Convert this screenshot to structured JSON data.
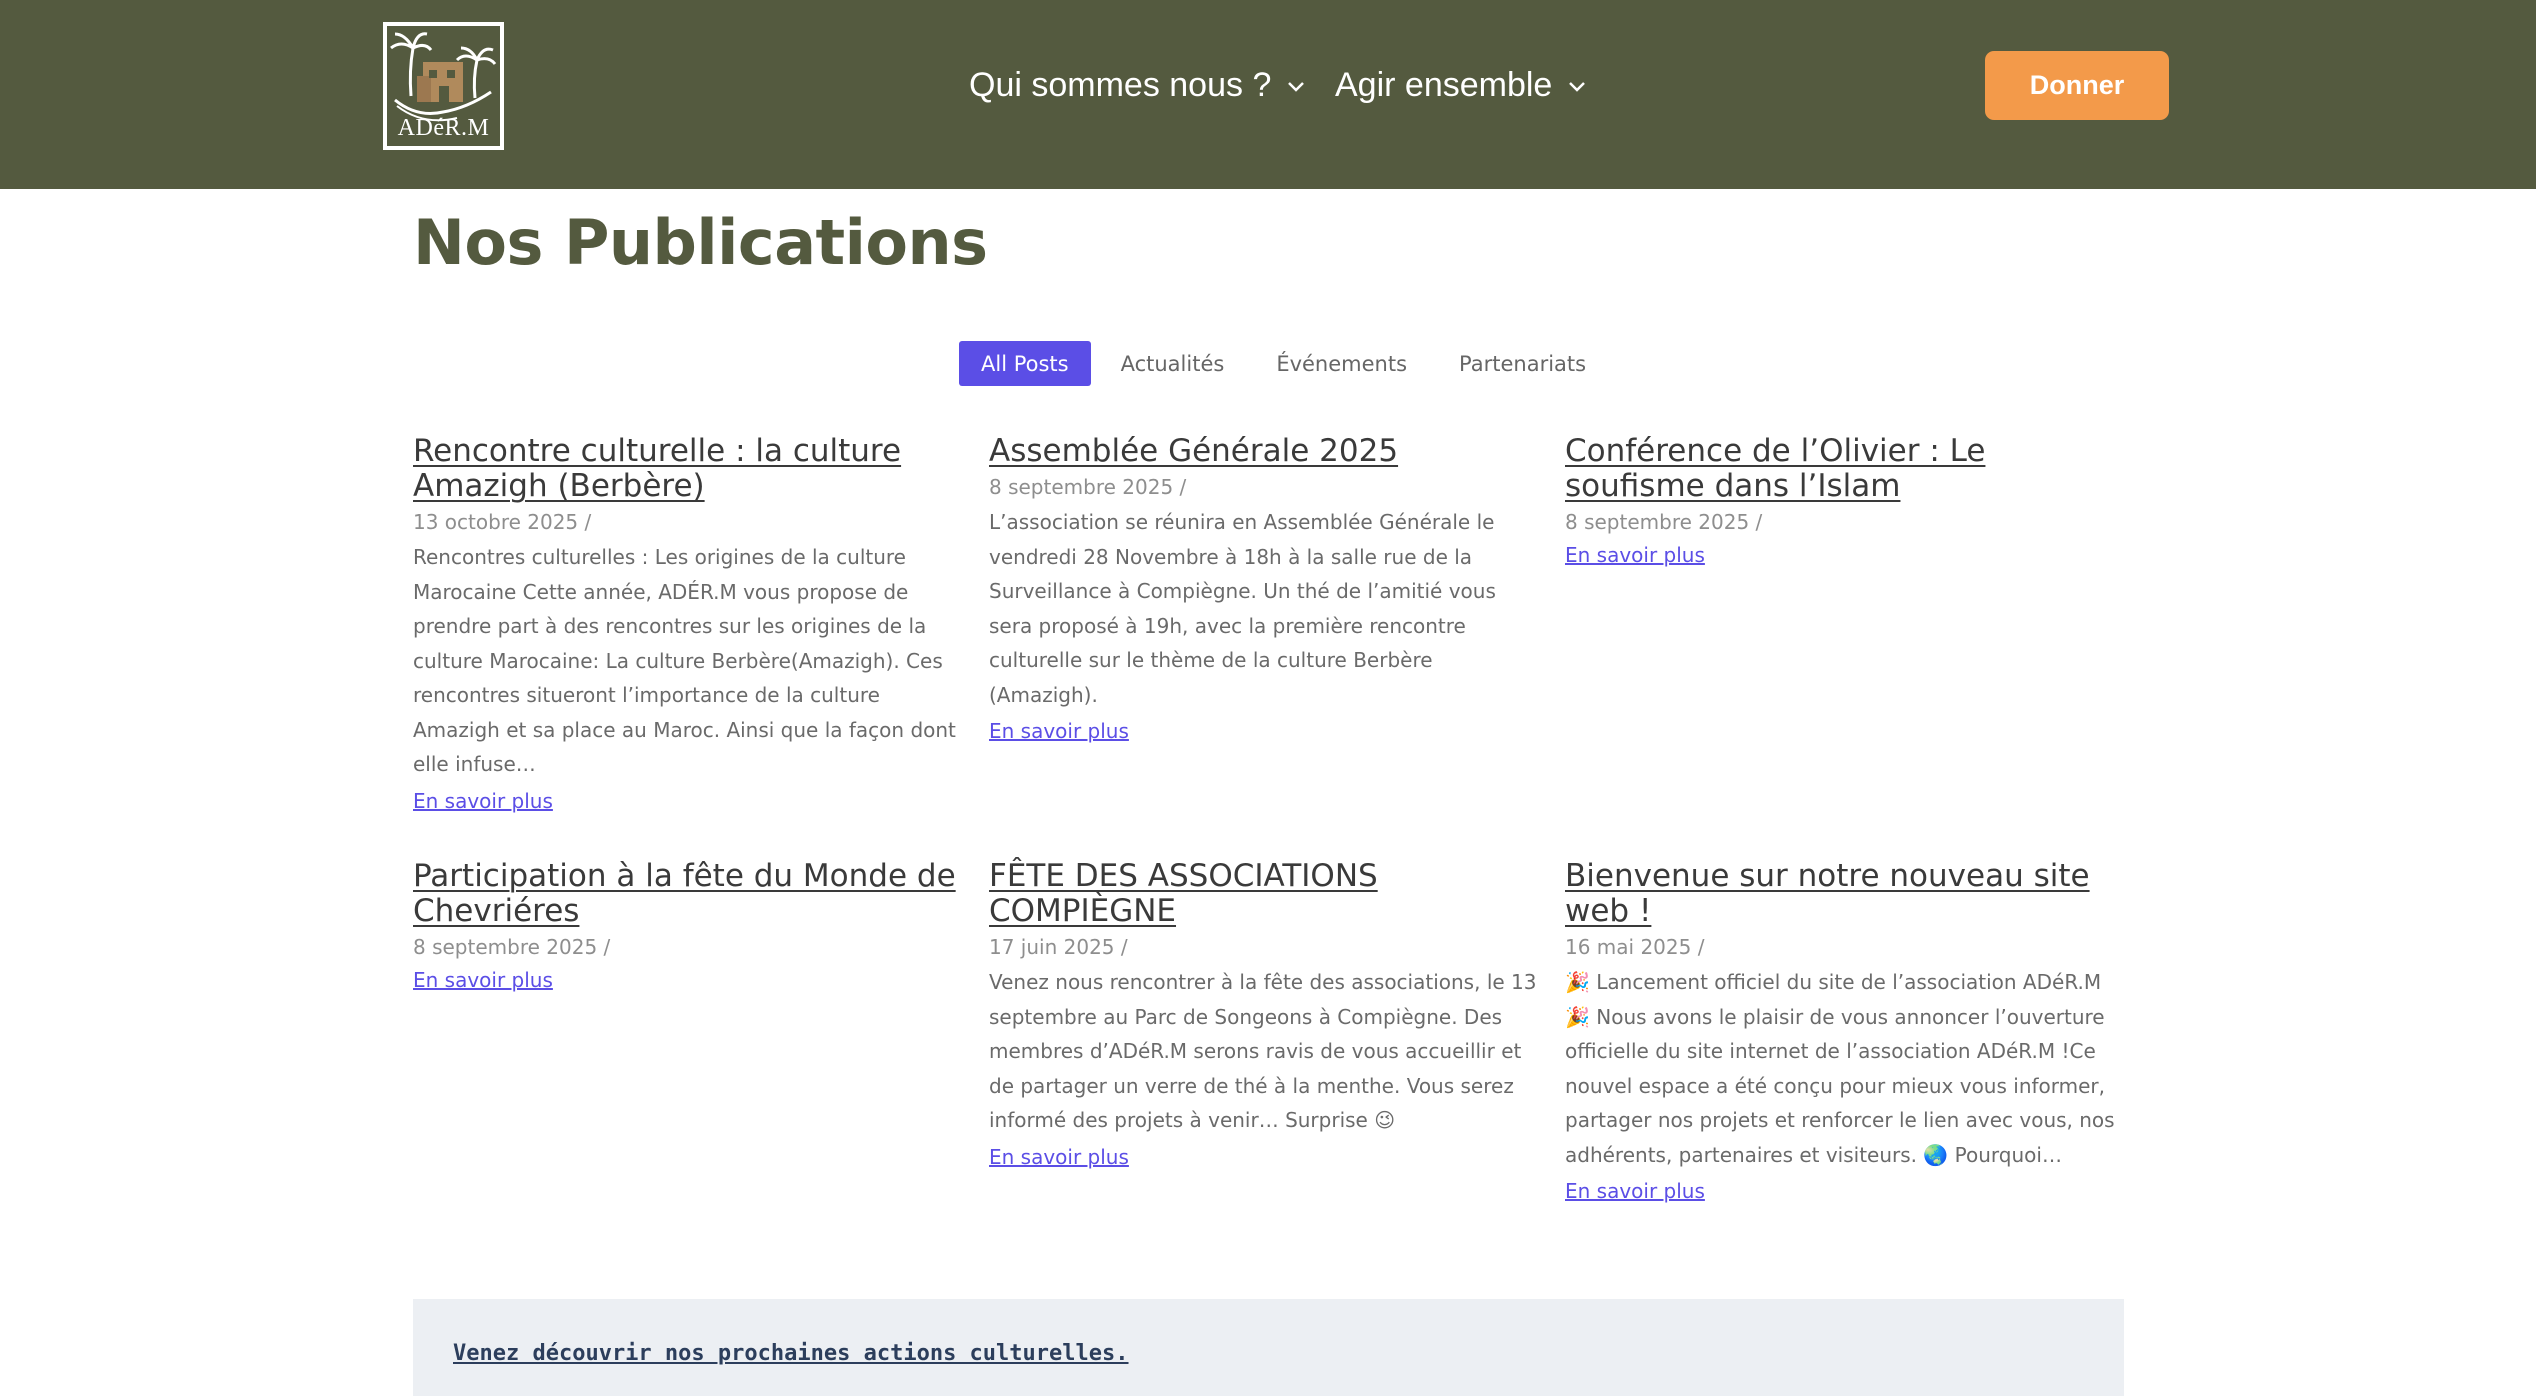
{
  "header": {
    "logo_text": "ADéR.M",
    "nav": [
      {
        "label": "Qui sommes nous ?"
      },
      {
        "label": "Agir ensemble"
      }
    ],
    "donate_label": "Donner",
    "colors": {
      "bar": "#545a3f",
      "donate": "#f39a4a"
    }
  },
  "page_title": "Nos Publications",
  "filters": [
    {
      "label": "All Posts",
      "active": true
    },
    {
      "label": "Actualités",
      "active": false
    },
    {
      "label": "Événements",
      "active": false
    },
    {
      "label": "Partenariats",
      "active": false
    }
  ],
  "posts": [
    {
      "title": "Rencontre culturelle : la culture Amazigh (Berbère)",
      "date": "13 octobre 2025 /",
      "excerpt": "Rencontres culturelles : Les origines de la culture Marocaine Cette année, ADÉR.M  vous propose de prendre part à des rencontres sur les origines de la culture Marocaine: La culture Berbère(Amazigh). Ces rencontres situeront l’importance de la culture Amazigh et sa place au Maroc. Ainsi que la façon dont elle infuse…",
      "more": "En savoir plus"
    },
    {
      "title": "Assemblée Générale 2025",
      "date": "8 septembre 2025 /",
      "excerpt": "L’association se réunira en Assemblée Générale le vendredi 28 Novembre à 18h à la salle rue de la Surveillance à Compiègne. Un thé de l’amitié vous sera proposé à 19h, avec la première rencontre culturelle sur le thème de la culture Berbère (Amazigh).",
      "more": "En savoir plus"
    },
    {
      "title": "Conférence de l’Olivier : Le soufisme dans l’Islam",
      "date": "8 septembre 2025 /",
      "excerpt": "",
      "more": "En savoir plus"
    },
    {
      "title": "Participation à la fête du Monde de Chevriéres",
      "date": "8 septembre 2025 /",
      "excerpt": "",
      "more": "En savoir plus"
    },
    {
      "title": "FÊTE DES ASSOCIATIONS COMPIÈGNE",
      "date": "17 juin 2025 /",
      "excerpt": "Venez nous rencontrer à la fête des associations, le 13 septembre au Parc de Songeons à Compiègne. Des membres d’ADéR.M serons ravis de vous accueillir et de partager un verre de thé à la menthe. Vous serez informé des projets à venir… Surprise 😉",
      "more": "En savoir plus"
    },
    {
      "title": "Bienvenue sur notre nouveau site web !",
      "date": "16 mai 2025 /",
      "excerpt": "🎉 Lancement officiel du site de l’association ADéR.M 🎉 Nous avons le plaisir de vous annoncer l’ouverture officielle du site internet de l’association ADéR.M !Ce nouvel espace a été conçu pour mieux vous informer, partager nos projets et renforcer le lien avec vous, nos adhérents, partenaires et visiteurs. 🌏 Pourquoi…",
      "more": "En savoir plus"
    }
  ],
  "band": {
    "link": "Venez découvrir nos prochaines actions culturelles."
  }
}
